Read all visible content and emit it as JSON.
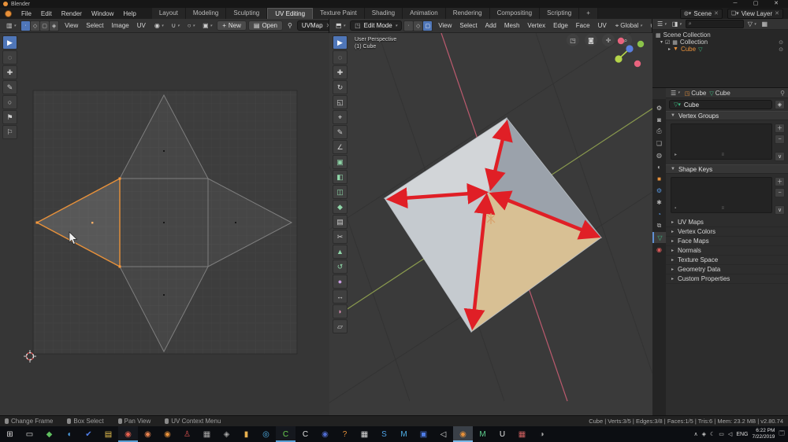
{
  "window": {
    "title": "Blender",
    "minimize": "─",
    "maximize": "▢",
    "close": "✕"
  },
  "topbar": {
    "menus": [
      {
        "label": "File"
      },
      {
        "label": "Edit"
      },
      {
        "label": "Render"
      },
      {
        "label": "Window"
      },
      {
        "label": "Help"
      }
    ],
    "tabs": [
      {
        "label": "Layout"
      },
      {
        "label": "Modeling"
      },
      {
        "label": "Sculpting"
      },
      {
        "label": "UV Editing",
        "cls": "active"
      },
      {
        "label": "Texture Paint"
      },
      {
        "label": "Shading"
      },
      {
        "label": "Animation"
      },
      {
        "label": "Rendering"
      },
      {
        "label": "Compositing"
      },
      {
        "label": "Scripting"
      },
      {
        "label": "+"
      }
    ],
    "scene_label": "Scene",
    "view_layer_label": "View Layer"
  },
  "uv_editor": {
    "header": {
      "menus": [
        {
          "label": "View"
        },
        {
          "label": "Select"
        },
        {
          "label": "Image"
        },
        {
          "label": "UV"
        }
      ],
      "mode_buttons": [
        {
          "name": "uv-select-vertex",
          "glyph": "∙",
          "cls": "active"
        },
        {
          "name": "uv-select-edge",
          "glyph": "◇"
        },
        {
          "name": "uv-select-face",
          "glyph": "▢"
        },
        {
          "name": "uv-select-island",
          "glyph": "◈"
        }
      ],
      "new_button": "New",
      "open_button": "Open",
      "uvmap_value": "UVMap"
    },
    "toolbar": [
      {
        "name": "select-box-tool",
        "glyph": "▶",
        "cls": "active"
      },
      {
        "name": "select-circle-tool",
        "glyph": "◌"
      },
      {
        "name": "cursor-tool",
        "glyph": "✚"
      },
      {
        "name": "annotate-tool",
        "glyph": "✎"
      },
      {
        "name": "grab-tool",
        "glyph": "○"
      },
      {
        "name": "relax-tool",
        "glyph": "⚑"
      },
      {
        "name": "pin-tool",
        "glyph": "⚐"
      }
    ]
  },
  "viewport3d": {
    "header": {
      "mode": "Edit Mode",
      "mode_buttons": [
        {
          "name": "select-mode-vertex",
          "glyph": "∙"
        },
        {
          "name": "select-mode-edge",
          "glyph": "◇"
        },
        {
          "name": "select-mode-face",
          "glyph": "▢",
          "cls": "active"
        }
      ],
      "menus": [
        {
          "label": "View"
        },
        {
          "label": "Select"
        },
        {
          "label": "Add"
        },
        {
          "label": "Mesh"
        },
        {
          "label": "Vertex"
        },
        {
          "label": "Edge"
        },
        {
          "label": "Face"
        },
        {
          "label": "UV"
        }
      ],
      "orientation": "Global"
    },
    "overlay": {
      "line1": "User Perspective",
      "line2": "(1) Cube"
    },
    "toolbar": [
      {
        "name": "select-box-tool",
        "glyph": "▶",
        "cls": "active"
      },
      {
        "name": "select-circle-tool",
        "glyph": "◌"
      },
      {
        "name": "move-tool",
        "glyph": "✚"
      },
      {
        "name": "rotate-tool",
        "glyph": "↻"
      },
      {
        "name": "scale-tool",
        "glyph": "◱"
      },
      {
        "name": "transform-tool",
        "glyph": "⌖"
      },
      {
        "name": "annotate-tool",
        "glyph": "✎"
      },
      {
        "name": "measure-tool",
        "glyph": "∠"
      },
      {
        "name": "add-cube-tool",
        "glyph": "▣",
        "color": "#8fd6a8"
      },
      {
        "name": "extrude-region-tool",
        "glyph": "◧",
        "color": "#8fd6a8"
      },
      {
        "name": "inset-faces-tool",
        "glyph": "◫",
        "color": "#8fd6a8"
      },
      {
        "name": "bevel-tool",
        "glyph": "◆",
        "color": "#8fd6a8"
      },
      {
        "name": "loop-cut-tool",
        "glyph": "▤"
      },
      {
        "name": "knife-tool",
        "glyph": "✂"
      },
      {
        "name": "poly-build-tool",
        "glyph": "▲",
        "color": "#8fd6a8"
      },
      {
        "name": "spin-tool",
        "glyph": "↺",
        "color": "#8fd6a8"
      },
      {
        "name": "smooth-tool",
        "glyph": "●",
        "color": "#c79be0"
      },
      {
        "name": "edge-slide-tool",
        "glyph": "↔"
      },
      {
        "name": "shrink-fatten-tool",
        "glyph": "◗",
        "color": "#e08fb6"
      },
      {
        "name": "shear-tool",
        "glyph": "▱"
      }
    ]
  },
  "outliner": {
    "search_value": "",
    "rows": [
      {
        "label": "Scene Collection"
      },
      {
        "label": "Collection"
      },
      {
        "label": "Cube"
      }
    ]
  },
  "properties": {
    "breadcrumb": {
      "object_name": "Cube",
      "data_name": "Cube"
    },
    "name_field_value": "Cube",
    "open_panels": [
      {
        "label": "Vertex Groups"
      },
      {
        "label": "Shape Keys"
      }
    ],
    "collapsed_panels": [
      {
        "label": "UV Maps"
      },
      {
        "label": "Vertex Colors"
      },
      {
        "label": "Face Maps"
      },
      {
        "label": "Normals"
      },
      {
        "label": "Texture Space"
      },
      {
        "label": "Geometry Data"
      },
      {
        "label": "Custom Properties"
      }
    ],
    "tabs": [
      {
        "name": "properties-tab-tool",
        "glyph": "⚙",
        "color": "#c8c8c8"
      },
      {
        "name": "properties-tab-render",
        "glyph": "◙",
        "color": "#b0b0b0"
      },
      {
        "name": "properties-tab-output",
        "glyph": "⎙",
        "color": "#b0b0b0"
      },
      {
        "name": "properties-tab-view-layer",
        "glyph": "❏",
        "color": "#b0b0b0"
      },
      {
        "name": "properties-tab-scene",
        "glyph": "◍",
        "color": "#b0b0b0"
      },
      {
        "name": "properties-tab-world",
        "glyph": "◐",
        "color": "#b0b0b0"
      },
      {
        "name": "properties-tab-object",
        "glyph": "■",
        "color": "#e8913a"
      },
      {
        "name": "properties-tab-modifiers",
        "glyph": "⚙",
        "color": "#5796e0"
      },
      {
        "name": "properties-tab-particles",
        "glyph": "✱",
        "color": "#b0b0b0"
      },
      {
        "name": "properties-tab-physics",
        "glyph": "◔",
        "color": "#5796e0"
      },
      {
        "name": "properties-tab-constraints",
        "glyph": "⧉",
        "color": "#b0b0b0"
      },
      {
        "name": "properties-tab-object-data",
        "glyph": "▽",
        "color": "#3bbf84",
        "cls": "active"
      },
      {
        "name": "properties-tab-material",
        "glyph": "◉",
        "color": "#e05a5a"
      }
    ]
  },
  "statusbar": {
    "hints": [
      {
        "label": "Change Frame"
      },
      {
        "label": "Box Select"
      },
      {
        "label": "Pan View"
      },
      {
        "label": "UV Context Menu"
      }
    ],
    "stats": "Cube | Verts:3/5 | Edges:3/8 | Faces:1/5 | Tris:6 | Mem: 23.2 MB | v2.80.74"
  },
  "taskbar": {
    "icons": [
      {
        "name": "start-button",
        "glyph": "⊞",
        "color": "#dcdcdc"
      },
      {
        "name": "task-view-icon",
        "glyph": "▭",
        "color": "#dcdcdc"
      },
      {
        "name": "maps-icon",
        "glyph": "◆",
        "color": "#5fbf5f"
      },
      {
        "name": "chat-icon",
        "glyph": "◖",
        "color": "#4fa3e8"
      },
      {
        "name": "onenote-icon",
        "glyph": "✔",
        "color": "#4f7de8"
      },
      {
        "name": "file-explorer-icon",
        "glyph": "▤",
        "color": "#e8c24f"
      },
      {
        "name": "chrome-icon",
        "glyph": "◉",
        "color": "#e8604f",
        "cls": "open"
      },
      {
        "name": "firefox-icon",
        "glyph": "◉",
        "color": "#e8824f"
      },
      {
        "name": "blender-icon",
        "glyph": "◉",
        "color": "#e8913a"
      },
      {
        "name": "app-red-icon",
        "glyph": "♙",
        "color": "#d8504f"
      },
      {
        "name": "photos-icon",
        "glyph": "▦",
        "color": "#a8a8a8"
      },
      {
        "name": "camera-app-icon",
        "glyph": "◈",
        "color": "#a8a8a8"
      },
      {
        "name": "candle-app-icon",
        "glyph": "▮",
        "color": "#e8b04f"
      },
      {
        "name": "swirl-app-icon",
        "glyph": "◎",
        "color": "#4fb0e8"
      },
      {
        "name": "camtasia-icon",
        "glyph": "C",
        "color": "#6bcf4f",
        "cls": "open"
      },
      {
        "name": "capture-app-icon",
        "glyph": "C",
        "color": "#e0e0e0"
      },
      {
        "name": "circle-app-icon",
        "glyph": "◉",
        "color": "#4f6bcf"
      },
      {
        "name": "help-app-icon",
        "glyph": "?",
        "color": "#e8913a"
      },
      {
        "name": "calculator-icon",
        "glyph": "▦",
        "color": "#dcdcdc"
      },
      {
        "name": "skype-icon",
        "glyph": "S",
        "color": "#4fa3e8"
      },
      {
        "name": "maya-icon",
        "glyph": "M",
        "color": "#4fb0e8"
      },
      {
        "name": "app-blue-icon",
        "glyph": "▣",
        "color": "#4f7de8"
      },
      {
        "name": "audio-app-icon",
        "glyph": "◁",
        "color": "#dcdcdc"
      },
      {
        "name": "blender-focused-icon",
        "glyph": "◉",
        "color": "#e8913a",
        "cls": "focused"
      },
      {
        "name": "maya-green-icon",
        "glyph": "M",
        "color": "#5fcf8f"
      },
      {
        "name": "unreal-icon",
        "glyph": "U",
        "color": "#e6e6e6"
      },
      {
        "name": "ms-store-icon",
        "glyph": "▦",
        "color": "#cf5f5f"
      },
      {
        "name": "settings-app-icon",
        "glyph": "◑",
        "color": "#a8a8a8"
      }
    ],
    "tray": {
      "icons": [
        {
          "name": "tray-chevron-icon",
          "glyph": "∧"
        },
        {
          "name": "tray-security-icon",
          "glyph": "◈"
        },
        {
          "name": "tray-network-icon",
          "glyph": "☾"
        },
        {
          "name": "tray-chat-icon",
          "glyph": "▭"
        },
        {
          "name": "tray-volume-icon",
          "glyph": "◁"
        }
      ],
      "lang": "ENG",
      "time": "6:22 PM",
      "date": "7/22/2019"
    }
  },
  "colors": {
    "accent_blue": "#4f76b8",
    "selection_orange": "#e8913a",
    "annotation_red": "#e01f26",
    "face_tan": "#d8c094",
    "face_light": "#d2d5d8",
    "face_mid": "#9ba2ab",
    "data_green": "#3bbf84"
  }
}
